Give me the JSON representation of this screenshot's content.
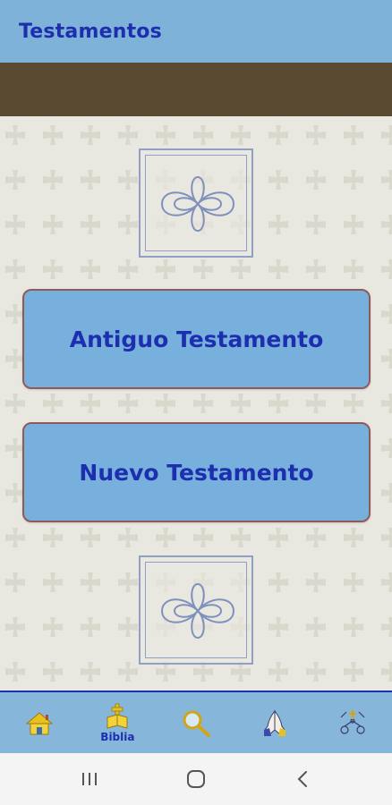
{
  "app_bar": {
    "title": "Testamentos"
  },
  "main": {
    "buttons": [
      {
        "label": "Antiguo Testamento"
      },
      {
        "label": "Nuevo Testamento"
      }
    ]
  },
  "bottom_nav": {
    "items": [
      {
        "icon": "home-icon",
        "label": ""
      },
      {
        "icon": "bible-icon",
        "label": "Biblia",
        "selected": true
      },
      {
        "icon": "search-icon",
        "label": ""
      },
      {
        "icon": "praying-hands-icon",
        "label": ""
      },
      {
        "icon": "rosary-icon",
        "label": ""
      }
    ]
  },
  "system_nav": {
    "items": [
      {
        "icon": "recent-apps-icon"
      },
      {
        "icon": "home-circle-icon"
      },
      {
        "icon": "back-icon"
      }
    ]
  },
  "colors": {
    "app_bar": "#7fb2d8",
    "title_text": "#1d2fae",
    "brown_band": "#5a4a32",
    "button_fill": "#78b0dd",
    "button_border": "#8e5b5b",
    "background_pattern": "#e9e8e0"
  }
}
